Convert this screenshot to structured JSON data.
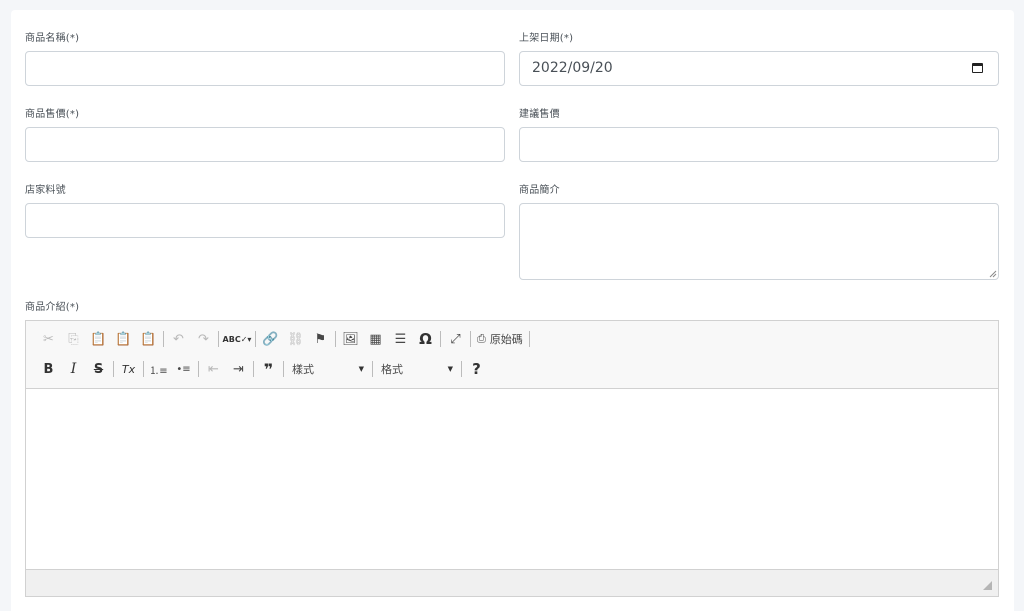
{
  "form": {
    "product_name": {
      "label": "商品名稱(*)",
      "value": ""
    },
    "launch_date": {
      "label": "上架日期(*)",
      "value": "2022/09/20"
    },
    "product_price": {
      "label": "商品售價(*)",
      "value": ""
    },
    "suggested_price": {
      "label": "建議售價",
      "value": ""
    },
    "store_sku": {
      "label": "店家料號",
      "value": ""
    },
    "product_summary": {
      "label": "商品簡介",
      "value": ""
    },
    "product_description": {
      "label": "商品介紹(*)"
    }
  },
  "editor": {
    "toolbar_row1": [
      {
        "name": "cut-icon",
        "glyph": "✂",
        "disabled": true
      },
      {
        "name": "copy-icon",
        "glyph": "⎘",
        "disabled": true
      },
      {
        "name": "paste-icon",
        "glyph": "📋",
        "disabled": false
      },
      {
        "name": "paste-text-icon",
        "glyph": "📋",
        "disabled": false
      },
      {
        "name": "paste-word-icon",
        "glyph": "📋",
        "disabled": false
      },
      "sep",
      {
        "name": "undo-icon",
        "glyph": "↶",
        "disabled": true
      },
      {
        "name": "redo-icon",
        "glyph": "↷",
        "disabled": true
      },
      "sep",
      {
        "name": "spellcheck-icon",
        "glyph": "ABC✓▾",
        "disabled": false
      },
      "sep",
      {
        "name": "link-icon",
        "glyph": "🔗",
        "disabled": false
      },
      {
        "name": "unlink-icon",
        "glyph": "⛓",
        "disabled": true
      },
      {
        "name": "anchor-flag-icon",
        "glyph": "⚑",
        "disabled": false
      },
      "sep",
      {
        "name": "image-icon",
        "glyph": "🖼",
        "disabled": false
      },
      {
        "name": "table-icon",
        "glyph": "▦",
        "disabled": false
      },
      {
        "name": "horizontal-line-icon",
        "glyph": "☰",
        "disabled": false
      },
      {
        "name": "special-char-icon",
        "glyph": "Ω",
        "disabled": false
      },
      "sep",
      {
        "name": "maximize-icon",
        "glyph": "⤢",
        "disabled": false
      },
      "sep"
    ],
    "source_button": {
      "label": "原始碼"
    },
    "toolbar_row2": [
      {
        "name": "bold-icon",
        "glyph": "B",
        "disabled": false
      },
      {
        "name": "italic-icon",
        "glyph": "I",
        "disabled": false
      },
      {
        "name": "strike-icon",
        "glyph": "S",
        "disabled": false
      },
      "sep",
      {
        "name": "remove-format-icon",
        "glyph": "Tx",
        "disabled": false
      },
      "sep",
      {
        "name": "numbered-list-icon",
        "glyph": "⒈≡",
        "disabled": false
      },
      {
        "name": "bulleted-list-icon",
        "glyph": "•≡",
        "disabled": false
      },
      "sep",
      {
        "name": "outdent-icon",
        "glyph": "⇤",
        "disabled": true
      },
      {
        "name": "indent-icon",
        "glyph": "⇥",
        "disabled": false
      },
      "sep",
      {
        "name": "blockquote-icon",
        "glyph": "❞",
        "disabled": false
      },
      "sep"
    ],
    "styles_combo": {
      "label": "樣式"
    },
    "format_combo": {
      "label": "格式"
    },
    "help_icon": {
      "glyph": "?"
    }
  }
}
